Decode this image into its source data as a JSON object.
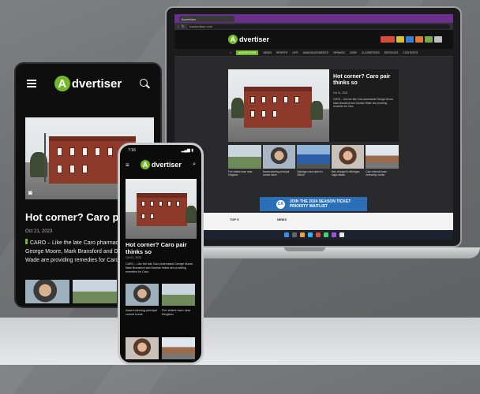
{
  "scene": {
    "background": "#6f7174",
    "accent_green": "#73b829",
    "banner_blue": "#2a6fb7",
    "browser_purple": "#6b2f8c"
  },
  "site": {
    "logo": "Advertiser",
    "logo_badge": "A",
    "logo_rest": "dvertiser"
  },
  "laptop": {
    "browser_tab": "Advertiser",
    "address": "tcadvertiser.com",
    "nav": [
      "ADVERTISER",
      "NEWS",
      "SPORTS",
      "LIFE",
      "ANNOUNCEMENTS",
      "OPINION",
      "JOBS",
      "CLASSIFIEDS",
      "SERVICES",
      "CONTESTS"
    ],
    "hero_headline": "Hot corner? Caro pair thinks so",
    "hero_date": "Oct 21, 2023",
    "hero_summary": "CARO – Like the late Caro pharmacist George Moore, Mark Bransford and Damian Wade are providing remedies for Caro.",
    "thumbs": [
      {
        "caption": "Fire strikes town near Kingston",
        "icon": "fire-photo"
      },
      {
        "caption": "Award-winning principal comes home",
        "icon": "portrait-photo"
      },
      {
        "caption": "Garbage cans stolen in Gilford",
        "icon": "truck-photo"
      },
      {
        "caption": "Man charged in Michigan tragic attack",
        "icon": "portrait-photo"
      },
      {
        "caption": "Caro extends town redevelop. funds",
        "icon": "street-photo"
      }
    ],
    "banner_logo": "CA",
    "banner_line1": "JOIN THE 2024 SEASON TICKET",
    "banner_line2": "PRIORITY WAITLIST",
    "lower_left": "TOP 5",
    "lower_mid": "NEWS"
  },
  "tablet": {
    "headline": "Hot corner? Caro pair thinks so",
    "date": "Oct 21, 2023",
    "summary": "CARO – Like the late Caro pharmacist George Moore, Mark Bransford and Damian Wade are providing remedies for Caro."
  },
  "phone": {
    "time": "7:16",
    "headline": "Hot corner? Caro pair thinks so",
    "date": "Oct 21, 2023",
    "summary": "CARO – Like the late Caro pharmacist George Moore, Mark Bransford and Damian Wade are providing remedies for Caro.",
    "thumb_captions": [
      "Award-winning principal comes home",
      "Fire strikes town near Kingston"
    ]
  }
}
